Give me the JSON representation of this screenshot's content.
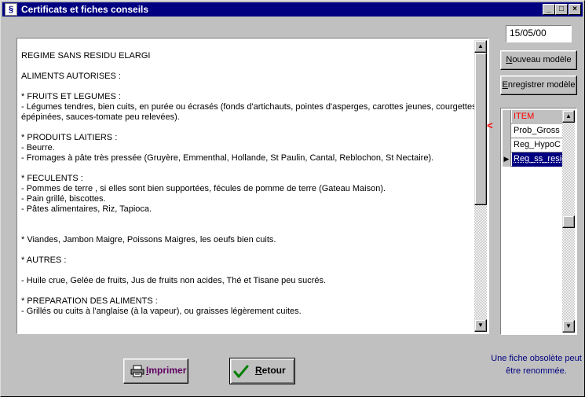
{
  "window": {
    "title": "Certificats et fiches conseils",
    "controls": [
      "_",
      "□",
      "×"
    ]
  },
  "date": "15/05/00",
  "buttons": {
    "nouveau_modele": "Nouveau modèle",
    "enregistrer_modele": "Enregistrer modèle",
    "imprimer": "Imprimer",
    "retour": "Retour"
  },
  "document_lines": [
    "REGIME SANS RESIDU ELARGI",
    "",
    "ALIMENTS AUTORISES :",
    "",
    "* FRUITS ET LEGUMES :",
    "- Légumes tendres, bien cuits, en purée ou écrasés (fonds d'artichauts, pointes d'asperges, carottes jeunes, courgettes",
    "épépinées, sauces-tomate peu relevées).",
    "",
    "* PRODUITS LAITIERS :",
    "- Beurre.",
    "- Fromages à pâte très pressée (Gruyère, Emmenthal, Hollande, St Paulin, Cantal, Reblochon, St Nectaire).",
    "",
    "* FECULENTS :",
    "- Pommes de terre , si elles sont bien supportées, fécules de pomme de terre (Gateau Maison).",
    "- Pain grillé, biscottes.",
    "- Pâtes alimentaires, Riz, Tapioca.",
    "",
    "",
    "* Viandes, Jambon Maigre, Poissons Maigres, les oeufs bien cuits.",
    "",
    "* AUTRES :",
    "",
    "- Huile crue, Gelée de fruits, Jus de fruits non acides, Thé et Tisane peu sucrés.",
    "",
    "* PREPARATION DES ALIMENTS :",
    "- Grillés ou cuits à l'anglaise (à la vapeur), ou graisses légèrement cuites."
  ],
  "grid": {
    "header": "ITEM",
    "rows": [
      "Prob_Gross",
      "Reg_HypoC",
      "Reg_ss_resid"
    ],
    "active_row_index": 2
  },
  "marker": "<",
  "note": "Une fiche obsolète peut être renommée.",
  "colors": {
    "titlebar": "#000080",
    "face": "#c0c0c0",
    "grid_header_text": "#ff0000",
    "selection": "#000080",
    "note_text": "#000080"
  },
  "icons": {
    "app": "app-icon",
    "print": "printer-icon",
    "back": "checkmark-icon"
  }
}
